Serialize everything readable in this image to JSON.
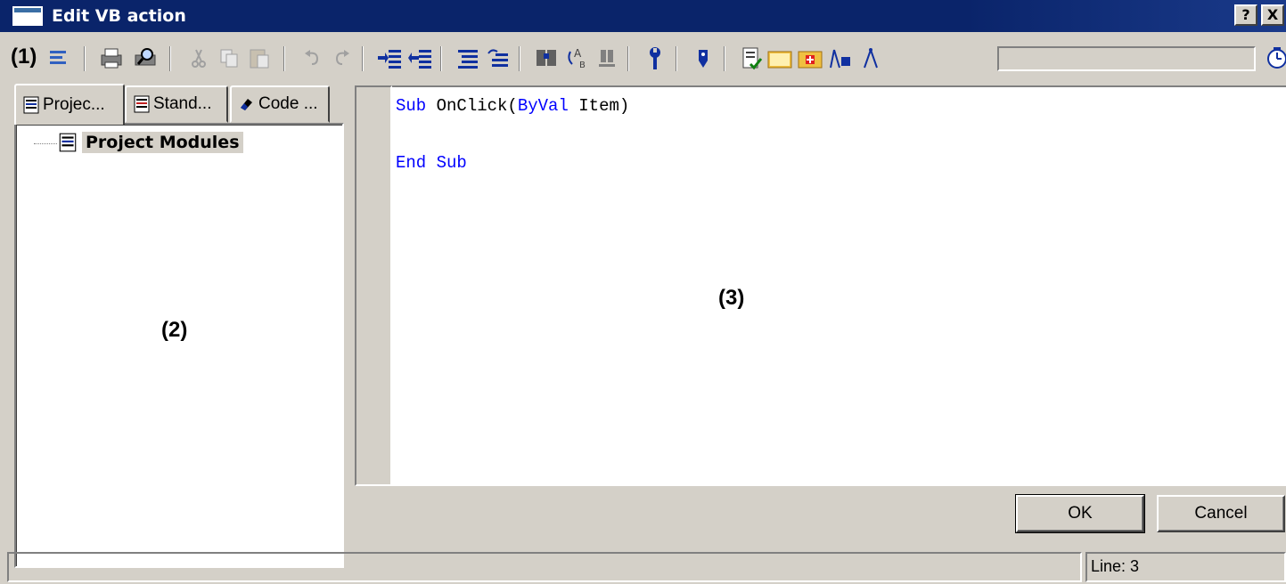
{
  "window": {
    "title": "Edit VB action",
    "help_button": "?",
    "close_button": "X"
  },
  "toolbar": {
    "callout": "(1)",
    "buttons": [
      "properties",
      "print",
      "print-preview",
      "cut",
      "copy",
      "paste",
      "undo",
      "redo",
      "indent",
      "outdent",
      "comment",
      "uncomment",
      "find",
      "replace",
      "goto",
      "settings",
      "tag",
      "check-syntax",
      "open-module",
      "insert-module",
      "property-assistant",
      "dynamic-wizard",
      "timer"
    ]
  },
  "left_panel": {
    "tabs": [
      {
        "label": "Projec...",
        "icon": "module-list-icon"
      },
      {
        "label": "Stand...",
        "icon": "module-list-icon"
      },
      {
        "label": "Code ...",
        "icon": "eraser-icon"
      }
    ],
    "tree": {
      "root_label": "Project Modules"
    },
    "callout": "(2)"
  },
  "editor": {
    "lines": [
      {
        "kw1": "Sub",
        "text1": " OnClick(",
        "kw2": "ByVal",
        "text2": " Item)"
      },
      {
        "kw1": "End Sub"
      }
    ],
    "callout": "(3)"
  },
  "buttons": {
    "ok": "OK",
    "cancel": "Cancel"
  },
  "status": {
    "line": "Line: 3"
  }
}
